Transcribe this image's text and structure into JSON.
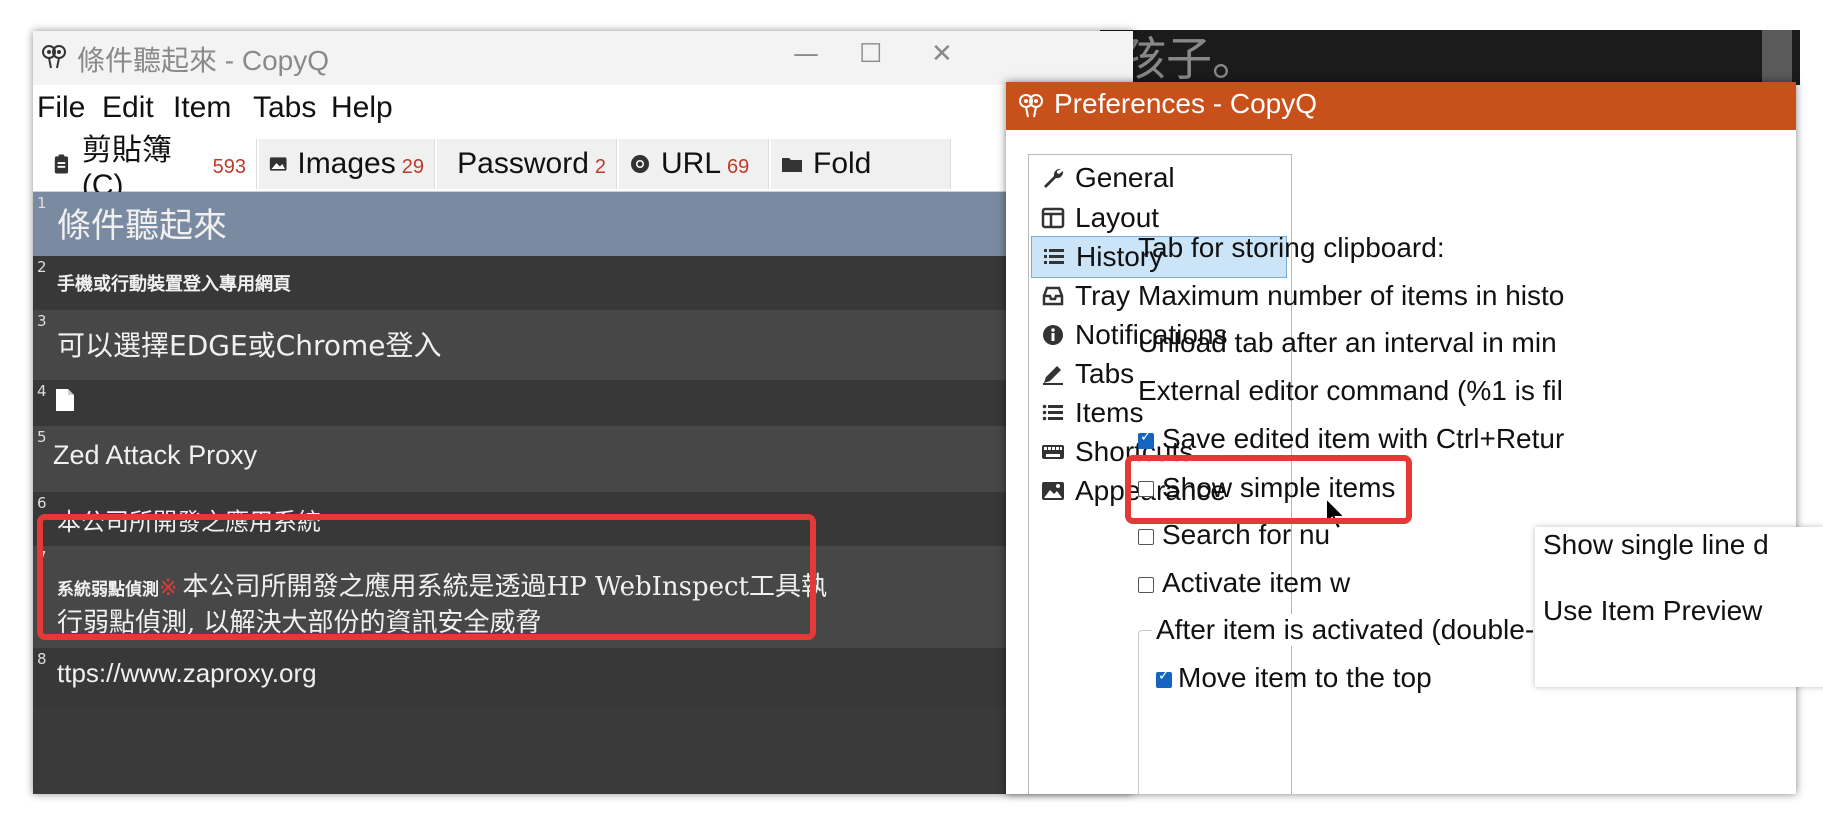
{
  "background_window": {
    "text": "孩子。"
  },
  "main_window": {
    "title": "條件聽起來 - CopyQ",
    "window_controls": {
      "minimize": "—",
      "maximize": "☐",
      "close": "✕"
    },
    "menu": [
      "File",
      "Edit",
      "Item",
      "Tabs",
      "Help"
    ],
    "tabs": [
      {
        "name": "剪貼簿(C)",
        "count": "593",
        "icon": "clipboard-icon"
      },
      {
        "name": "Images",
        "count": "29",
        "icon": "image-icon"
      },
      {
        "name": "Password",
        "count": "2",
        "icon": "key-icon"
      },
      {
        "name": "URL",
        "count": "69",
        "icon": "browser-icon"
      },
      {
        "name": "Fold",
        "count": "",
        "icon": "folder-icon"
      }
    ],
    "items": [
      {
        "num": "1",
        "text": "條件聽起來"
      },
      {
        "num": "2",
        "text": "手機或行動裝置登入專用網頁"
      },
      {
        "num": "3",
        "text": "可以選擇EDGE或Chrome登入"
      },
      {
        "num": "4",
        "text": ""
      },
      {
        "num": "5",
        "text": "Zed Attack Proxy"
      },
      {
        "num": "6",
        "text": "本公司所開發之應用系統"
      },
      {
        "num": "7",
        "prefix": "系統弱點偵測",
        "marker": "※",
        "line1": "本公司所開發之應用系統是透過HP WebInspect工具執",
        "line2": "行弱點偵測, 以解決大部份的資訊安全威脅"
      },
      {
        "num": "8",
        "text": "ttps://www.zaproxy.org"
      }
    ]
  },
  "preferences": {
    "title": "Preferences - CopyQ",
    "nav": [
      {
        "label": "General",
        "icon": "wrench-icon"
      },
      {
        "label": "Layout",
        "icon": "layout-icon"
      },
      {
        "label": "History",
        "icon": "list-icon",
        "selected": true
      },
      {
        "label": "Tray",
        "icon": "tray-icon"
      },
      {
        "label": "Notifications",
        "icon": "info-icon"
      },
      {
        "label": "Tabs",
        "icon": "pen-icon"
      },
      {
        "label": "Items",
        "icon": "items-list-icon"
      },
      {
        "label": "Shortcuts",
        "icon": "keyboard-icon"
      },
      {
        "label": "Appearance",
        "icon": "picture-icon"
      }
    ],
    "settings": {
      "tab_storing": "Tab for storing clipboard:",
      "max_items": "Maximum number of items in histo",
      "unload_tab": "Unload tab after an interval in min",
      "external_editor": "External editor command (%1 is fil",
      "save_edited": "Save edited item with Ctrl+Retur",
      "show_simple": "Show simple items",
      "search_numbers": "Search for nu",
      "activate_item": "Activate item w",
      "after_activated": "After item is activated (double-cli",
      "move_top": "Move item to the top"
    },
    "tooltip": {
      "line1": "Show single line d",
      "line2": "Use Item Preview"
    }
  }
}
